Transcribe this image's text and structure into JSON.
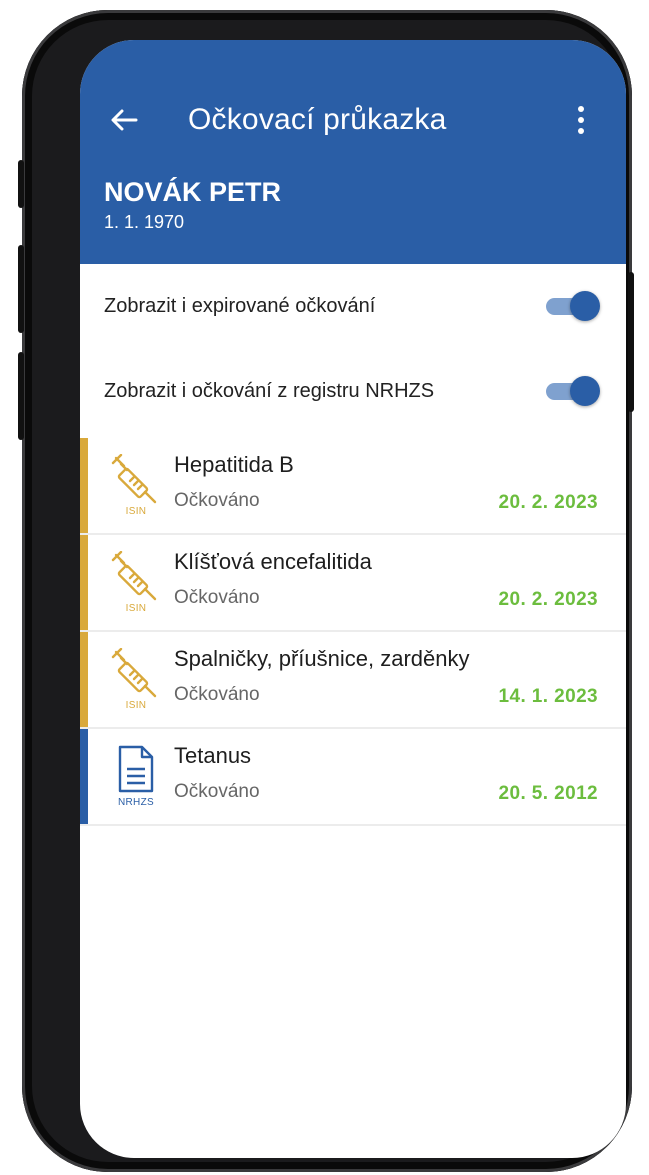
{
  "appbar": {
    "title": "Očkovací průkazka",
    "color": "#2a5ea6"
  },
  "patient": {
    "name": "NOVÁK PETR",
    "dob": "1. 1. 1970"
  },
  "toggles": [
    {
      "label": "Zobrazit i expirované očkování",
      "on": true
    },
    {
      "label": "Zobrazit i očkování z registru NRHZS",
      "on": true
    }
  ],
  "vaccinations": [
    {
      "name": "Hepatitida B",
      "status": "Očkováno",
      "date": "20. 2. 2023",
      "source": "ISIN",
      "icon": "syringe-icon",
      "accent": "#d9a93b"
    },
    {
      "name": "Klíšťová encefalitida",
      "status": "Očkováno",
      "date": "20. 2. 2023",
      "source": "ISIN",
      "icon": "syringe-icon",
      "accent": "#d9a93b"
    },
    {
      "name": "Spalničky, příušnice, zarděnky",
      "status": "Očkováno",
      "date": "14. 1. 2023",
      "source": "ISIN",
      "icon": "syringe-icon",
      "accent": "#d9a93b"
    },
    {
      "name": "Tetanus",
      "status": "Očkováno",
      "date": "20. 5. 2012",
      "source": "NRHZS",
      "icon": "document-icon",
      "accent": "#2a5ea6"
    }
  ],
  "colors": {
    "date_green": "#6cbd3e",
    "isin_gold": "#d9a93b",
    "nrhzs_blue": "#2a5ea6"
  }
}
